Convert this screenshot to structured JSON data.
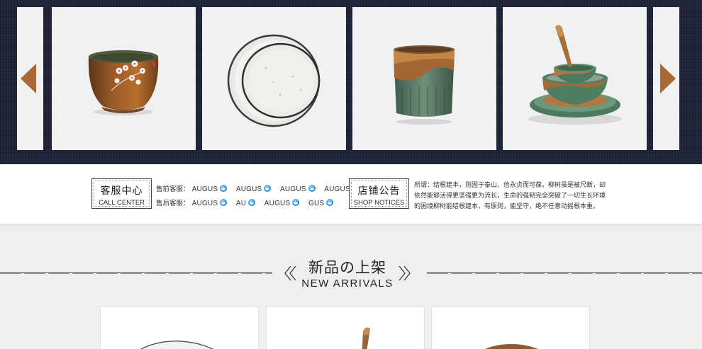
{
  "carousel": {
    "prev_label": "previous",
    "next_label": "next",
    "products": [
      {
        "name": "plum-blossom-cup",
        "icon": "teacup-icon"
      },
      {
        "name": "white-plate",
        "icon": "plate-icon"
      },
      {
        "name": "green-glazed-cup",
        "icon": "tumbler-icon"
      },
      {
        "name": "bowl-set",
        "icon": "bowl-stack-icon"
      }
    ]
  },
  "service": {
    "call_center": {
      "cn": "客服中心",
      "en": "CALL CENTER"
    },
    "pre_sale_label": "售前客服：",
    "pre_sale_agents": [
      "AUGUS",
      "AUGUS",
      "AUGUS",
      "AUGUS"
    ],
    "after_sale_label": "售后客服：",
    "after_sale_agents": [
      "AUGUS",
      "AU",
      "AUGUS",
      "GUS"
    ],
    "shop_notices": {
      "cn": "店铺公告",
      "en": "SHOP NOTICES"
    },
    "notice_text": "所谓：结根建本，则固于泰山、信永贞而可葆。柳树虽是被尺断，却依然能够活得更坚强更为流长，生命的强韧完全突破了一切生长环境的困境柳树能结根建本，有原则，能坚守，绝不任意动摇根本重。"
  },
  "new_arrivals": {
    "title_cn": "新品の上架",
    "title_en": "NEW ARRIVALS"
  },
  "colors": {
    "banner_bg": "#1d2438",
    "arrow": "#a8683a",
    "card_bg": "#f1f1f1"
  }
}
